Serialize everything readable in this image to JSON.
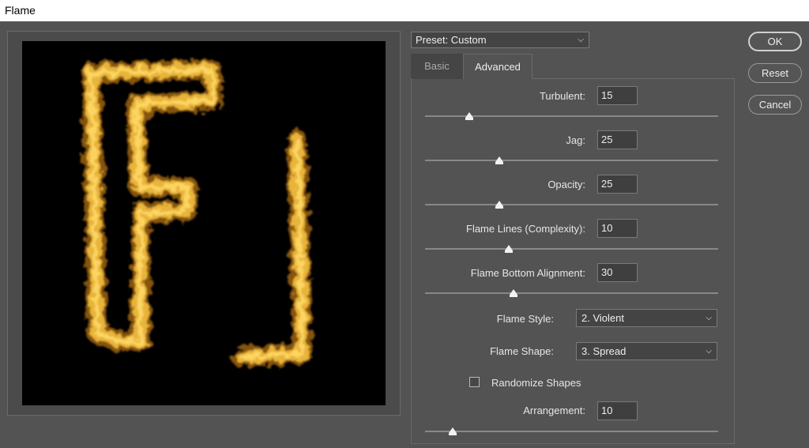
{
  "window": {
    "title": "Flame"
  },
  "preset": {
    "label": "Preset: Custom"
  },
  "tabs": [
    {
      "label": "Basic",
      "active": false
    },
    {
      "label": "Advanced",
      "active": true
    }
  ],
  "params": [
    {
      "label": "Turbulent:",
      "value": "15",
      "slider_fraction": 0.15
    },
    {
      "label": "Jag:",
      "value": "25",
      "slider_fraction": 0.25
    },
    {
      "label": "Opacity:",
      "value": "25",
      "slider_fraction": 0.25
    },
    {
      "label": "Flame Lines (Complexity):",
      "value": "10",
      "slider_fraction": 0.28
    },
    {
      "label": "Flame Bottom Alignment:",
      "value": "30",
      "slider_fraction": 0.3
    }
  ],
  "flame_style": {
    "label": "Flame Style:",
    "value": "2. Violent"
  },
  "flame_shape": {
    "label": "Flame Shape:",
    "value": "3. Spread"
  },
  "randomize": {
    "label": "Randomize Shapes",
    "checked": false
  },
  "arrangement": {
    "label": "Arrangement:",
    "value": "10",
    "slider_fraction": 0.09
  },
  "buttons": {
    "ok": "OK",
    "reset": "Reset",
    "cancel": "Cancel"
  },
  "colors": {
    "flame": "#e8b43a",
    "flame_glow": "#ffd866",
    "background": "#535353"
  }
}
